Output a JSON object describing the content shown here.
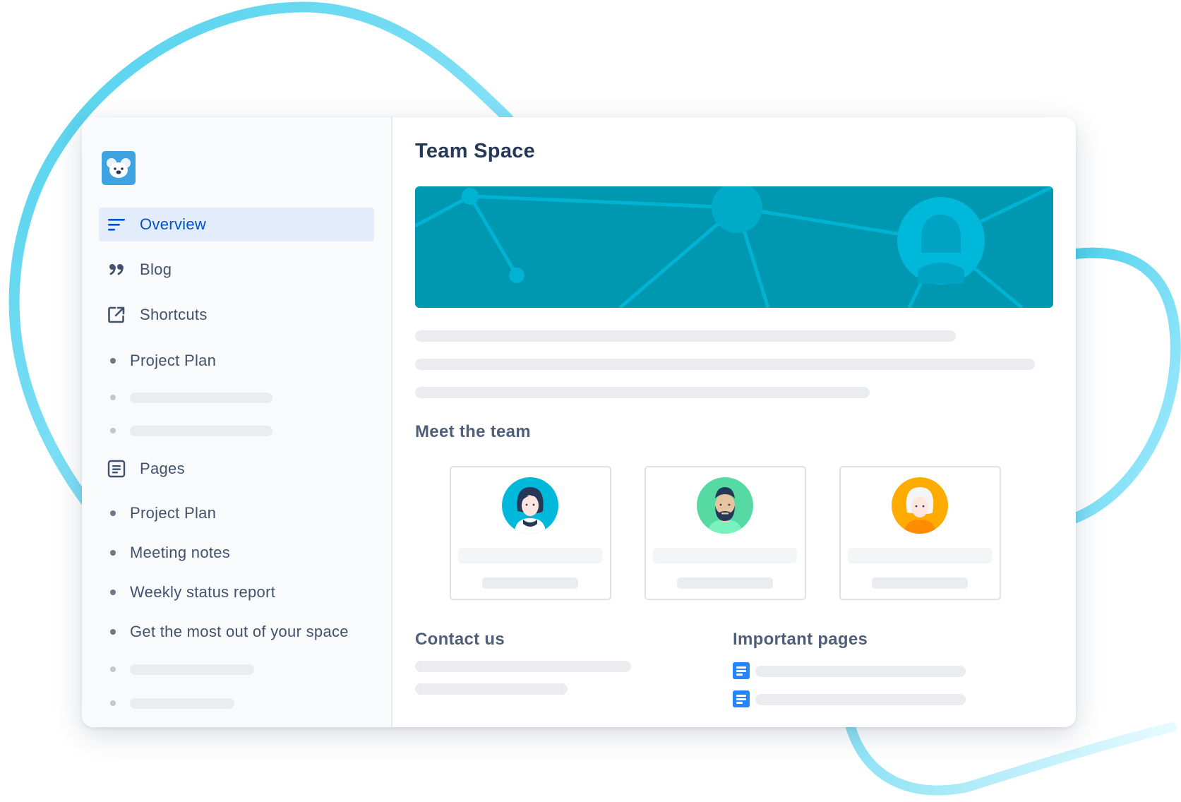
{
  "app": {
    "logo_icon": "koala-logo-icon",
    "accent_color": "#0052cc",
    "banner_color": "#0097b0"
  },
  "sidebar": {
    "nav": [
      {
        "label": "Overview",
        "icon": "overview-lines-icon",
        "active": true
      },
      {
        "label": "Blog",
        "icon": "quote-icon",
        "active": false
      },
      {
        "label": "Shortcuts",
        "icon": "external-link-icon",
        "active": false
      }
    ],
    "shortcuts": [
      {
        "label": "Project Plan"
      }
    ],
    "pages_section": {
      "label": "Pages",
      "icon": "page-icon"
    },
    "pages": [
      {
        "label": "Project Plan"
      },
      {
        "label": "Meeting notes"
      },
      {
        "label": "Weekly status report"
      },
      {
        "label": "Get the most out of your space"
      }
    ]
  },
  "main": {
    "title": "Team Space",
    "banner_icon": "network-avatar-icon",
    "meet_team_title": "Meet the team",
    "team": [
      {
        "avatar": "woman-dark-hair-avatar",
        "color": "#00b8d9"
      },
      {
        "avatar": "bearded-man-avatar",
        "color": "#57d9a3"
      },
      {
        "avatar": "elderly-woman-avatar",
        "color": "#ffab00"
      }
    ],
    "contact_title": "Contact us",
    "important_title": "Important pages",
    "important_icon": "document-icon"
  }
}
